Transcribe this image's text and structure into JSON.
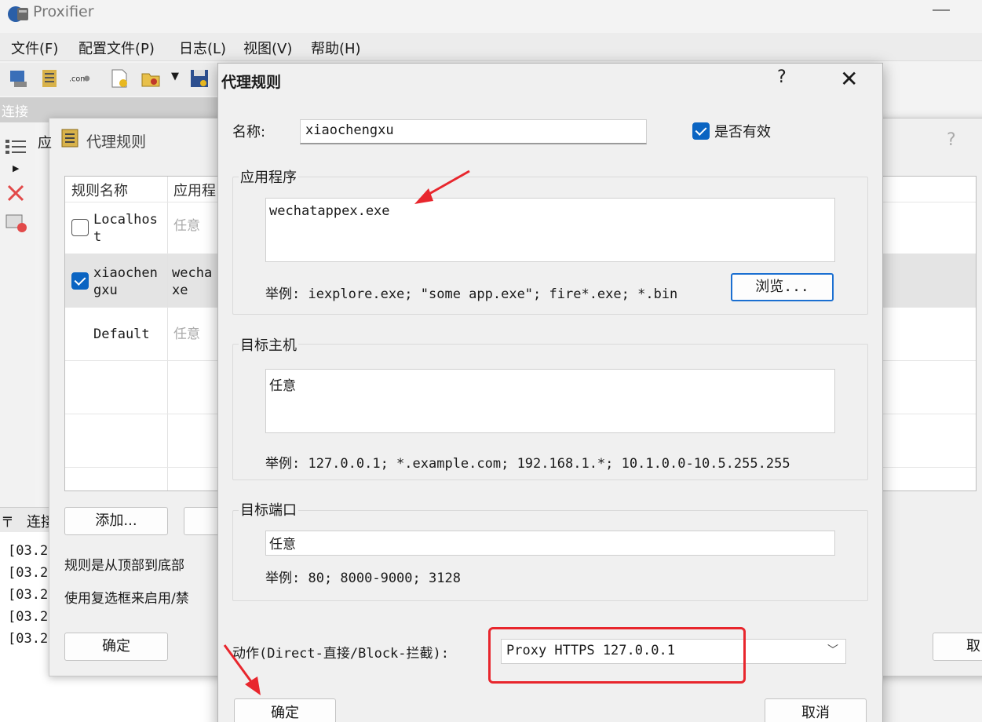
{
  "app": {
    "title": "Proxifier"
  },
  "menu": [
    "文件(F)",
    "配置文件(P)",
    "日志(L)",
    "视图(V)",
    "帮助(H)"
  ],
  "connections": {
    "header": "连接",
    "log_tab": "连接",
    "log_lines": [
      "[03.2",
      "[03.2",
      "[03.2",
      "[03.2",
      "[03.2"
    ]
  },
  "bg_dialog": {
    "title": "代理规则",
    "partial_label": "应",
    "help": "?",
    "columns": [
      "规则名称",
      "应用程"
    ],
    "rows": [
      {
        "name_l1": "Localhos",
        "name_l2": "t",
        "app_l1": "任意",
        "app_l2": "",
        "checked": false
      },
      {
        "name_l1": "xiaochen",
        "name_l2": "gxu",
        "app_l1": "wecha",
        "app_l2": "xe",
        "checked": true
      },
      {
        "name_l1": "Default",
        "name_l2": "",
        "app_l1": "任意",
        "app_l2": "",
        "checked": null
      }
    ],
    "add_button": "添加...",
    "note1": "规则是从顶部到底部",
    "note2": "使用复选框来启用/禁",
    "ok_button": "确定",
    "right_partial_button": "取"
  },
  "fg_dialog": {
    "title": "代理规则",
    "help": "?",
    "close": "✕",
    "name_label": "名称:",
    "name_value": "xiaochengxu",
    "enabled_label": "是否有效",
    "enabled": true,
    "app_group": "应用程序",
    "app_value": "wechatappex.exe",
    "app_example": "举例: iexplore.exe; \"some app.exe\"; fire*.exe; *.bin",
    "browse_button": "浏览...",
    "host_group": "目标主机",
    "host_value": "任意",
    "host_example": "举例: 127.0.0.1; *.example.com; 192.168.1.*; 10.1.0.0-10.5.255.255",
    "port_group": "目标端口",
    "port_value": "任意",
    "port_example": "举例: 80; 8000-9000; 3128",
    "action_label": "动作(Direct-直接/Block-拦截):",
    "action_value": "Proxy HTTPS 127.0.0.1",
    "ok_button": "确定",
    "cancel_button": "取消"
  },
  "colors": {
    "accent": "#0a64c2",
    "annotation_red": "#e8262d"
  }
}
